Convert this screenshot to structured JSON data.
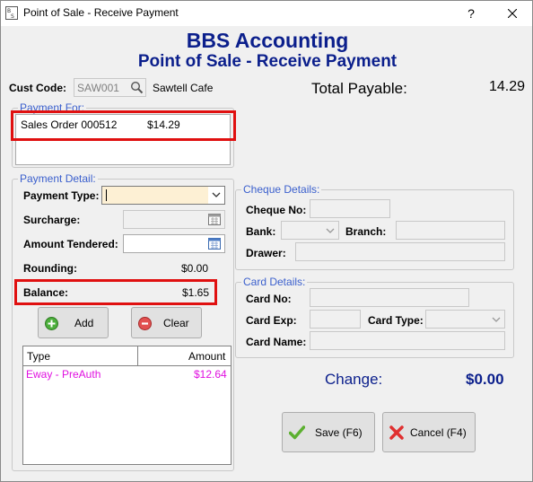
{
  "window": {
    "title": "Point of Sale - Receive Payment",
    "help": "?",
    "close": "close"
  },
  "header": {
    "company": "BBS Accounting",
    "subtitle": "Point of Sale - Receive Payment"
  },
  "customer": {
    "code_label": "Cust Code:",
    "code_value": "SAW001",
    "name": "Sawtell Cafe"
  },
  "total": {
    "label": "Total Payable:",
    "value": "14.29"
  },
  "payment_for": {
    "legend": "Payment For:",
    "items": [
      {
        "ref": "Sales Order 000512",
        "amount": "$14.29"
      }
    ]
  },
  "payment_detail": {
    "legend": "Payment Detail:",
    "type_label": "Payment Type:",
    "type_value": "",
    "surcharge_label": "Surcharge:",
    "surcharge_value": "",
    "tendered_label": "Amount Tendered:",
    "tendered_value": "",
    "rounding_label": "Rounding:",
    "rounding_value": "$0.00",
    "balance_label": "Balance:",
    "balance_value": "$1.65",
    "add_label": "Add",
    "clear_label": "Clear"
  },
  "payments_grid": {
    "columns": [
      "Type",
      "Amount"
    ],
    "rows": [
      {
        "type": "Eway - PreAuth",
        "amount": "$12.64"
      }
    ]
  },
  "cheque": {
    "legend": "Cheque Details:",
    "no_label": "Cheque No:",
    "bank_label": "Bank:",
    "branch_label": "Branch:",
    "drawer_label": "Drawer:"
  },
  "card": {
    "legend": "Card Details:",
    "no_label": "Card No:",
    "exp_label": "Card Exp:",
    "type_label": "Card Type:",
    "name_label": "Card Name:"
  },
  "change": {
    "label": "Change:",
    "value": "$0.00"
  },
  "actions": {
    "save_label": "Save (F6)",
    "cancel_label": "Cancel (F4)"
  },
  "colors": {
    "title_blue": "#0b1f8c",
    "legend_blue": "#3a5fcd",
    "highlight_red": "#e01010",
    "row_magenta": "#e010e0",
    "field_yellow": "#fdf0d4"
  },
  "icons": [
    "app-icon",
    "search-icon",
    "calendar-icon",
    "chevron-down-icon",
    "plus-icon",
    "x-circle-icon",
    "check-icon",
    "cross-icon",
    "close-icon"
  ]
}
